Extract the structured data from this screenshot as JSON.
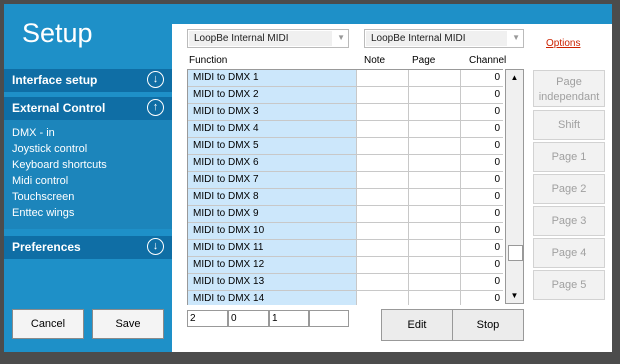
{
  "sidebar": {
    "title": "Setup",
    "interface_setup": {
      "label": "Interface setup"
    },
    "external_control": {
      "label": "External Control",
      "items": [
        "DMX - in",
        "Joystick control",
        "Keyboard shortcuts",
        "Midi control",
        "Touchscreen",
        "Enttec wings"
      ]
    },
    "preferences": {
      "label": "Preferences"
    },
    "cancel_label": "Cancel",
    "save_label": "Save"
  },
  "midi": {
    "input_device": "LoopBe Internal MIDI",
    "output_device": "LoopBe Internal MIDI",
    "options_label": "Options"
  },
  "table": {
    "headers": {
      "function": "Function",
      "note": "Note",
      "page": "Page",
      "channel": "Channel"
    },
    "rows": [
      {
        "function": "MIDI to DMX 1",
        "note": "",
        "page": "",
        "channel": "0"
      },
      {
        "function": "MIDI to DMX 2",
        "note": "",
        "page": "",
        "channel": "0"
      },
      {
        "function": "MIDI to DMX 3",
        "note": "",
        "page": "",
        "channel": "0"
      },
      {
        "function": "MIDI to DMX 4",
        "note": "",
        "page": "",
        "channel": "0"
      },
      {
        "function": "MIDI to DMX 5",
        "note": "",
        "page": "",
        "channel": "0"
      },
      {
        "function": "MIDI to DMX 6",
        "note": "",
        "page": "",
        "channel": "0"
      },
      {
        "function": "MIDI to DMX 7",
        "note": "",
        "page": "",
        "channel": "0"
      },
      {
        "function": "MIDI to DMX 8",
        "note": "",
        "page": "",
        "channel": "0"
      },
      {
        "function": "MIDI to DMX 9",
        "note": "",
        "page": "",
        "channel": "0"
      },
      {
        "function": "MIDI to DMX 10",
        "note": "",
        "page": "",
        "channel": "0"
      },
      {
        "function": "MIDI to DMX 11",
        "note": "",
        "page": "",
        "channel": "0"
      },
      {
        "function": "MIDI to DMX 12",
        "note": "",
        "page": "",
        "channel": "0"
      },
      {
        "function": "MIDI to DMX 13",
        "note": "",
        "page": "",
        "channel": "0"
      },
      {
        "function": "MIDI to DMX 14",
        "note": "",
        "page": "",
        "channel": "0"
      }
    ]
  },
  "page_buttons": [
    "Page independant",
    "Shift",
    "Page 1",
    "Page 2",
    "Page 3",
    "Page 4",
    "Page 5"
  ],
  "status": [
    "2",
    "0",
    "1",
    ""
  ],
  "actions": {
    "edit_label": "Edit",
    "stop_label": "Stop"
  },
  "colors": {
    "sidebar": "#1e90c8",
    "section_header": "#0f6ea5",
    "function_cell": "#cce7fb",
    "options_link": "#cc2200"
  }
}
